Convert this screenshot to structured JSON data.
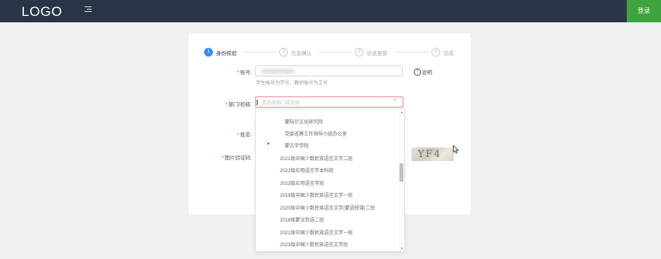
{
  "header": {
    "logo": "LOGO",
    "login_label": "登录"
  },
  "steps": [
    {
      "num": "1",
      "label": "身份校验"
    },
    {
      "num": "2",
      "label": "信息确认"
    },
    {
      "num": "3",
      "label": "信息更新"
    },
    {
      "num": "4",
      "label": "完成"
    }
  ],
  "form": {
    "account_label": "账号:",
    "account_hint": "学生账号为学号，教师账号为工号",
    "help_label": "说明",
    "dept_label": "部门/班级:",
    "dept_placeholder": "请选择部门或班级",
    "name_label": "姓名:",
    "captcha_label": "图片验证码:",
    "captcha_text": "YF4"
  },
  "dropdown": {
    "items": [
      {
        "label": "蒙陆尔文化研究院"
      },
      {
        "label": "党委巡察工作领导小组办公室"
      },
      {
        "label": "蒙古学学院"
      },
      {
        "label": "2021级中国少数民族语言文学二班"
      },
      {
        "label": "2022级应用语言学本科班"
      },
      {
        "label": "2023级应用语言学班"
      },
      {
        "label": "2019级中国少数民族语言文学一班"
      },
      {
        "label": "2020级中国少数民族语言文学(蒙语授课)二班"
      },
      {
        "label": "2016级蒙汉双语二班"
      },
      {
        "label": "2021级中国少数民族语言文学一班"
      },
      {
        "label": "2023级中国少数民族语言文学班"
      }
    ]
  }
}
